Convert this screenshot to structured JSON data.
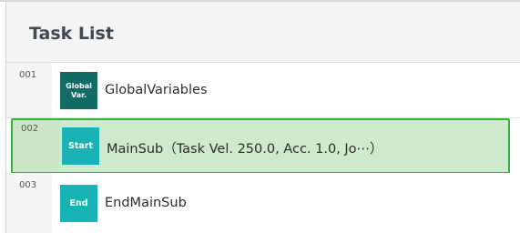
{
  "panel": {
    "title": "Task List"
  },
  "rows": [
    {
      "num": "001",
      "tag_line1": "Global",
      "tag_line2": "Var.",
      "label": "GlobalVariables"
    },
    {
      "num": "002",
      "tag_line1": "Start",
      "label": "MainSub（Task Vel. 250.0, Acc. 1.0, Jo⋯）",
      "selected": true
    },
    {
      "num": "003",
      "tag_line1": "End",
      "label": "EndMainSub"
    }
  ],
  "colors": {
    "selection_border": "#35b33d",
    "selection_fill": "#cfe9cc",
    "tag_dark": "#136b66",
    "tag_teal": "#19b3b5"
  }
}
